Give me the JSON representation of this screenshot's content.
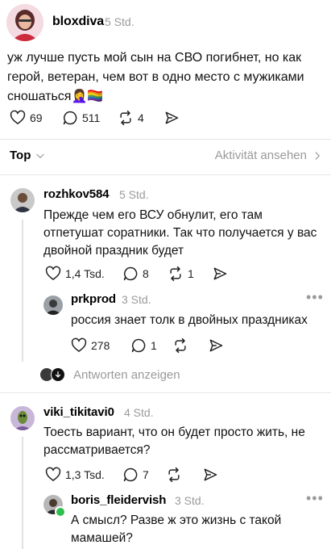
{
  "post": {
    "username": "bloxdiva",
    "time": "5 Std.",
    "text": "уж лучше пусть мой сын на СВО погибнет, но как герой, ветеран, чем вот в одно место с мужиками сношаться🤦‍♀️🏳️‍🌈",
    "likes": "69",
    "replies": "511",
    "reposts": "4"
  },
  "sort": {
    "label": "Top",
    "activity_link": "Aktivität ansehen"
  },
  "comments": [
    {
      "username": "rozhkov584",
      "time": "5 Std.",
      "text": "Прежде чем его ВСУ обнулит, его там отпетушат соратники. Так что получается у вас двойной праздник будет",
      "likes": "1,4 Tsd.",
      "replies": "8",
      "reposts": "1"
    },
    {
      "username": "prkprod",
      "time": "3 Std.",
      "text": "россия знает толк в двойных праздниках",
      "likes": "278",
      "replies": "1",
      "reposts": ""
    },
    {
      "username": "viki_tikitavi0",
      "time": "4 Std.",
      "text": "Тоесть вариант, что он будет просто жить, не рассматривается?",
      "likes": "1,3 Tsd.",
      "replies": "7",
      "reposts": ""
    },
    {
      "username": "boris_fleidervish",
      "time": "3 Std.",
      "text": "А смысл? Разве ж это жизнь с такой мамашей?"
    }
  ],
  "show_replies": "Antworten anzeigen",
  "icons": {
    "like": "heart-icon",
    "reply": "comment-icon",
    "repost": "repost-icon",
    "share": "send-icon",
    "more": "more-icon",
    "chevron": "chevron-down-icon",
    "chevron_right": "chevron-right-icon"
  }
}
